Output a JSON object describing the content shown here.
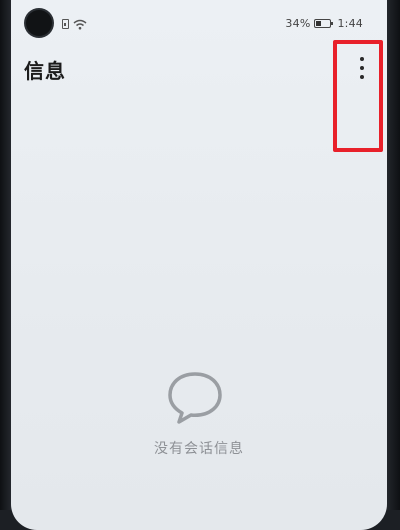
{
  "status_bar": {
    "battery_percent": "34%",
    "battery_level": 0.34,
    "time": "1:44",
    "icons": [
      "sim-card-icon",
      "wifi-icon",
      "battery-icon"
    ]
  },
  "header": {
    "title": "信息",
    "menu_icon": "more-vertical-icon"
  },
  "empty_state": {
    "icon": "chat-bubble-icon",
    "message": "没有会话信息"
  },
  "colors": {
    "highlight": "#e8202a",
    "screen_bg": "#ecf0f4",
    "empty_icon": "#9a9ea3"
  }
}
